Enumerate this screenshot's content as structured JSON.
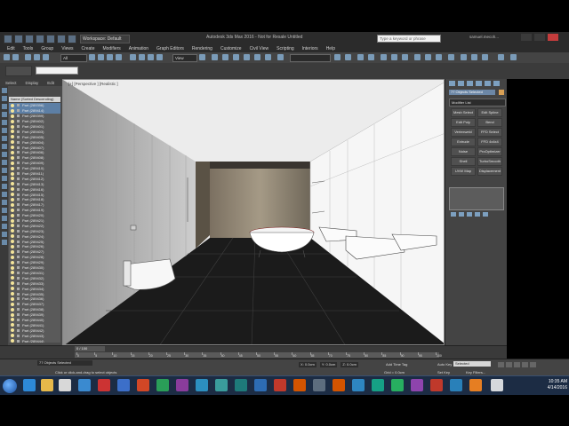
{
  "titlebar": {
    "workspace": "Workspace: Default",
    "app_title": "Autodesk 3ds Max 2016 - Not for Resale  Untitled",
    "search_placeholder": "Type a keyword or phrase",
    "user": "samuel.mecoh..."
  },
  "menu": [
    "Edit",
    "Tools",
    "Group",
    "Views",
    "Create",
    "Modifiers",
    "Animation",
    "Graph Editors",
    "Rendering",
    "Customize",
    "Civil View",
    "Scripting",
    "Interiors",
    "Help"
  ],
  "toolbar": {
    "selection_filter": "All",
    "coordinate_system": "View"
  },
  "explorer": {
    "tabs": [
      "Select",
      "Display",
      "Edit"
    ],
    "header": "Name (Sorted Descending)",
    "items": [
      "Part (289396)",
      "Part (289414)",
      "Part (289399)",
      "Part (289402)",
      "Part (289401)",
      "Part (289403)",
      "Part (289405)",
      "Part (289404)",
      "Part (289407)",
      "Part (289406)",
      "Part (289408)",
      "Part (289409)",
      "Part (289410)",
      "Part (289411)",
      "Part (289412)",
      "Part (289413)",
      "Part (289416)",
      "Part (289415)",
      "Part (289418)",
      "Part (289417)",
      "Part (289419)",
      "Part (289420)",
      "Part (289421)",
      "Part (289422)",
      "Part (289423)",
      "Part (289424)",
      "Part (289425)",
      "Part (289426)",
      "Part (289427)",
      "Part (289428)",
      "Part (289429)",
      "Part (289430)",
      "Part (289431)",
      "Part (289432)",
      "Part (289433)",
      "Part (289434)",
      "Part (289435)",
      "Part (289436)",
      "Part (289437)",
      "Part (289438)",
      "Part (289439)",
      "Part (289440)",
      "Part (289441)",
      "Part (289442)",
      "Part (289443)",
      "Part (289444)"
    ]
  },
  "viewport": {
    "label": "[+] [Perspective ] [Realistic ]"
  },
  "command_panel": {
    "object_name": "77 Objects Selected",
    "modifier_list": "Modifier List",
    "modifiers": [
      "Mesh Select",
      "Edit Spline",
      "Edit Poly",
      "Bend",
      "Vertexweld",
      "FFD Select",
      "Extrude",
      "FFD 4x4x4",
      "Noise",
      "ProOptimizer",
      "Shell",
      "TurboSmooth",
      "UVW Map",
      "Displacement"
    ]
  },
  "timeline": {
    "counter": "0 / 100",
    "ticks": [
      "0",
      "5",
      "10",
      "15",
      "20",
      "25",
      "30",
      "35",
      "40",
      "45",
      "50",
      "55",
      "60",
      "65",
      "70",
      "75",
      "80",
      "85",
      "90",
      "95",
      "100"
    ]
  },
  "status": {
    "selection": "77 Objects Selected",
    "hint": "Click or click-and-drag to select objects",
    "x": "X: 0.0cm",
    "y": "Y: 0.0cm",
    "z": "Z: 0.0cm",
    "grid": "Grid = 0.0cm",
    "add_time_tag": "Add Time Tag",
    "auto_key": "Auto Key",
    "auto_key_mode": "Selected",
    "set_key": "Set Key",
    "key_filters": "Key Filters..."
  },
  "taskbar": {
    "time": "10:35 AM",
    "date": "4/14/2016"
  },
  "colors": {
    "selection_blue": "#5d7fa5",
    "viewport_bg": "#eaeaea",
    "floor": "#1b1b1b"
  }
}
